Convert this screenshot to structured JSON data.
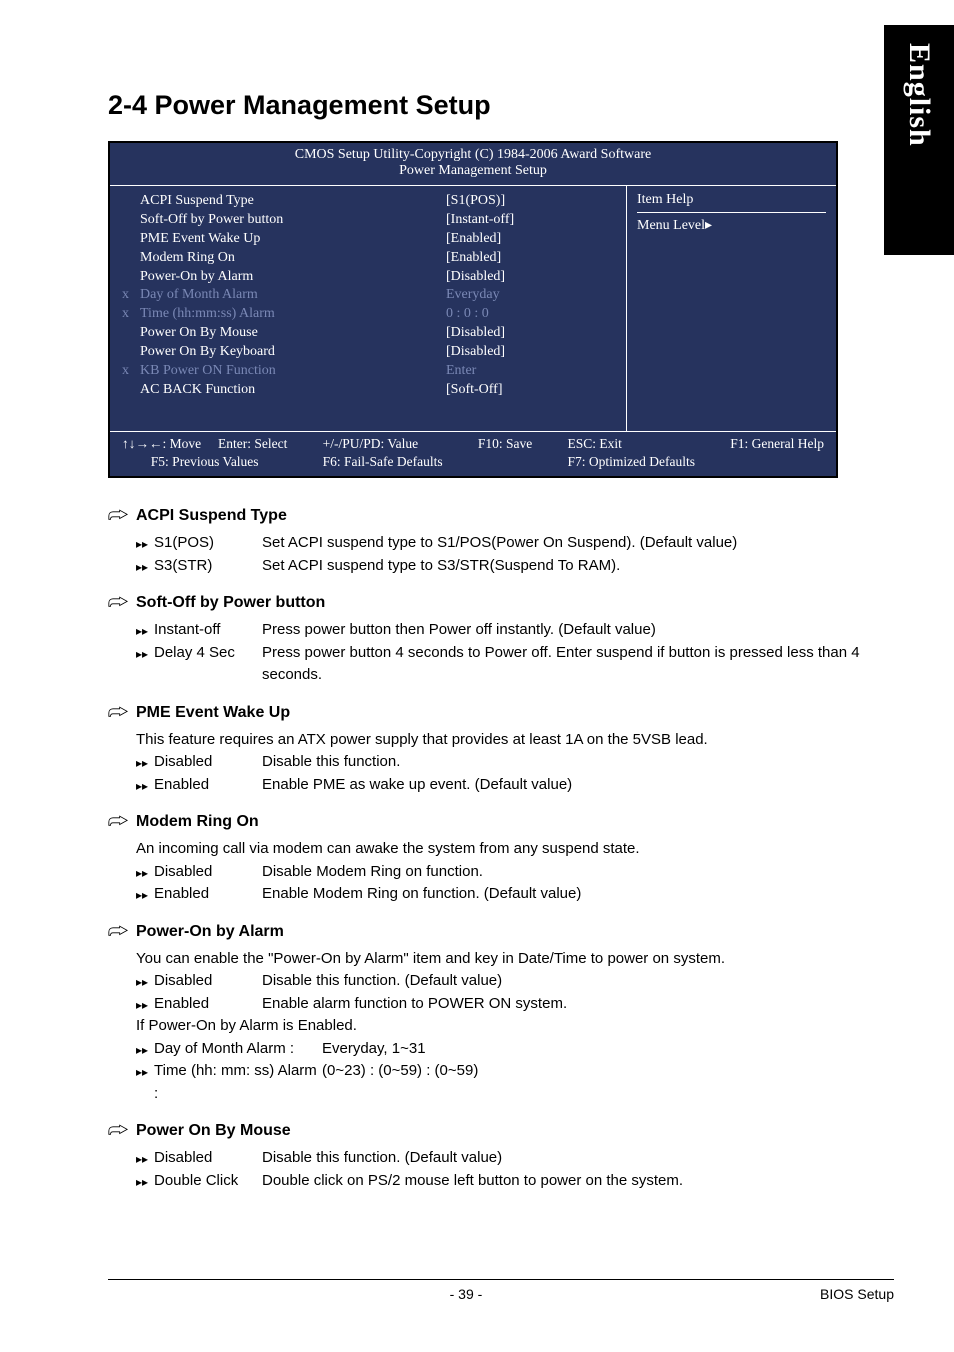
{
  "side_tab": "English",
  "section_title": "2-4   Power Management Setup",
  "bios": {
    "header_line1": "CMOS Setup Utility-Copyright (C) 1984-2006 Award Software",
    "header_line2": "Power Management Setup",
    "rows": [
      {
        "x": "",
        "greyed": false,
        "label": "ACPI Suspend Type",
        "val": "[S1(POS)]"
      },
      {
        "x": "",
        "greyed": false,
        "label": "Soft-Off by Power button",
        "val": "[Instant-off]"
      },
      {
        "x": "",
        "greyed": false,
        "label": "PME Event Wake Up",
        "val": "[Enabled]"
      },
      {
        "x": "",
        "greyed": false,
        "label": "Modem Ring On",
        "val": "[Enabled]"
      },
      {
        "x": "",
        "greyed": false,
        "label": "Power-On by Alarm",
        "val": "[Disabled]"
      },
      {
        "x": "x",
        "greyed": true,
        "label": "Day of Month Alarm",
        "val": "Everyday"
      },
      {
        "x": "x",
        "greyed": true,
        "label": "Time (hh:mm:ss) Alarm",
        "val": "0 : 0 : 0"
      },
      {
        "x": "",
        "greyed": false,
        "label": "Power On By Mouse",
        "val": "[Disabled]"
      },
      {
        "x": "",
        "greyed": false,
        "label": "Power On By Keyboard",
        "val": "[Disabled]"
      },
      {
        "x": "x",
        "greyed": true,
        "label": "KB Power ON Function",
        "val": "Enter"
      },
      {
        "x": "",
        "greyed": false,
        "label": "AC BACK Function",
        "val": "[Soft-Off]"
      }
    ],
    "help_title": "Item Help",
    "help_menu": "Menu Level▸",
    "footer": {
      "c1a": "↑↓→←: Move",
      "c1b": "Enter: Select",
      "c1c": "F5: Previous Values",
      "c2a": "+/-/PU/PD: Value",
      "c2b": "F6: Fail-Safe Defaults",
      "c3a": "F10: Save",
      "c4a": "ESC: Exit",
      "c4b": "F7: Optimized Defaults",
      "c5a": "F1: General Help"
    }
  },
  "items": [
    {
      "title": "ACPI Suspend Type",
      "opts": [
        {
          "name": "S1(POS)",
          "desc": "Set ACPI suspend type to S1/POS(Power On Suspend). (Default value)"
        },
        {
          "name": "S3(STR)",
          "desc": "Set ACPI suspend type to S3/STR(Suspend To RAM)."
        }
      ]
    },
    {
      "title": "Soft-Off by Power button",
      "opts": [
        {
          "name": "Instant-off",
          "desc": "Press power button then Power off instantly. (Default value)"
        },
        {
          "name": "Delay 4 Sec",
          "desc": "Press power button 4 seconds to Power off. Enter suspend if button is pressed less than 4 seconds."
        }
      ]
    },
    {
      "title": "PME Event Wake Up",
      "note": "This feature requires an ATX power supply that provides at least 1A on the 5VSB lead.",
      "opts": [
        {
          "name": "Disabled",
          "desc": "Disable this function."
        },
        {
          "name": "Enabled",
          "desc": "Enable PME as wake up event. (Default value)"
        }
      ]
    },
    {
      "title": "Modem Ring On",
      "note": "An incoming call via modem can awake the system from any suspend state.",
      "opts": [
        {
          "name": "Disabled",
          "desc": "Disable Modem Ring on function."
        },
        {
          "name": "Enabled",
          "desc": "Enable Modem Ring on function. (Default value)"
        }
      ]
    },
    {
      "title": "Power-On by Alarm",
      "note": "You can enable the \"Power-On by Alarm\" item and key in Date/Time to power on system.",
      "opts": [
        {
          "name": "Disabled",
          "desc": "Disable this function. (Default value)"
        },
        {
          "name": "Enabled",
          "desc": "Enable alarm function to POWER ON system."
        }
      ],
      "note2": "If Power-On by Alarm is Enabled.",
      "opts2": [
        {
          "name": "Day of Month Alarm :",
          "desc": "Everyday, 1~31",
          "wide": true
        },
        {
          "name": "Time (hh: mm: ss) Alarm :",
          "desc": "(0~23) : (0~59) : (0~59)",
          "wide": true
        }
      ]
    },
    {
      "title": "Power On By Mouse",
      "opts": [
        {
          "name": "Disabled",
          "desc": "Disable this function. (Default value)"
        },
        {
          "name": "Double Click",
          "desc": "Double click on PS/2 mouse left button to power on the system."
        }
      ]
    }
  ],
  "footer_page": "- 39 -",
  "footer_right": "BIOS Setup"
}
